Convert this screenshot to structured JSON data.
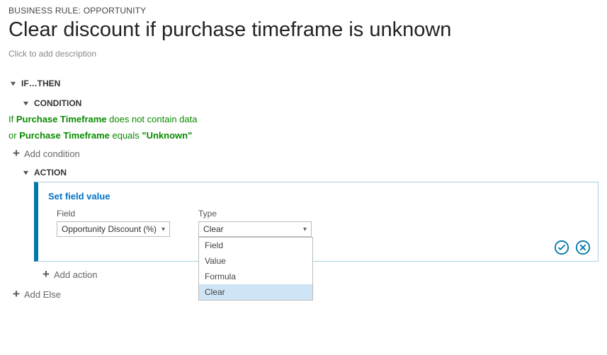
{
  "breadcrumb": "BUSINESS RULE: Opportunity",
  "title": "Clear discount if purchase timeframe is unknown",
  "description_placeholder": "Click to add description",
  "section_ifthen": "IF…THEN",
  "section_condition": "CONDITION",
  "section_action": "ACTION",
  "condition1": {
    "prefix": "If",
    "field": "Purchase Timeframe",
    "rest": "does not contain data"
  },
  "condition2": {
    "prefix": "or",
    "field": "Purchase Timeframe",
    "mid": "equals",
    "value": "\"Unknown\""
  },
  "add_condition_label": "Add condition",
  "add_action_label": "Add action",
  "add_else_label": "Add Else",
  "action_panel": {
    "title": "Set field value",
    "field_label": "Field",
    "field_value": "Opportunity Discount (%)",
    "type_label": "Type",
    "type_value": "Clear",
    "type_options": [
      "Field",
      "Value",
      "Formula",
      "Clear"
    ],
    "type_selected": "Clear"
  }
}
